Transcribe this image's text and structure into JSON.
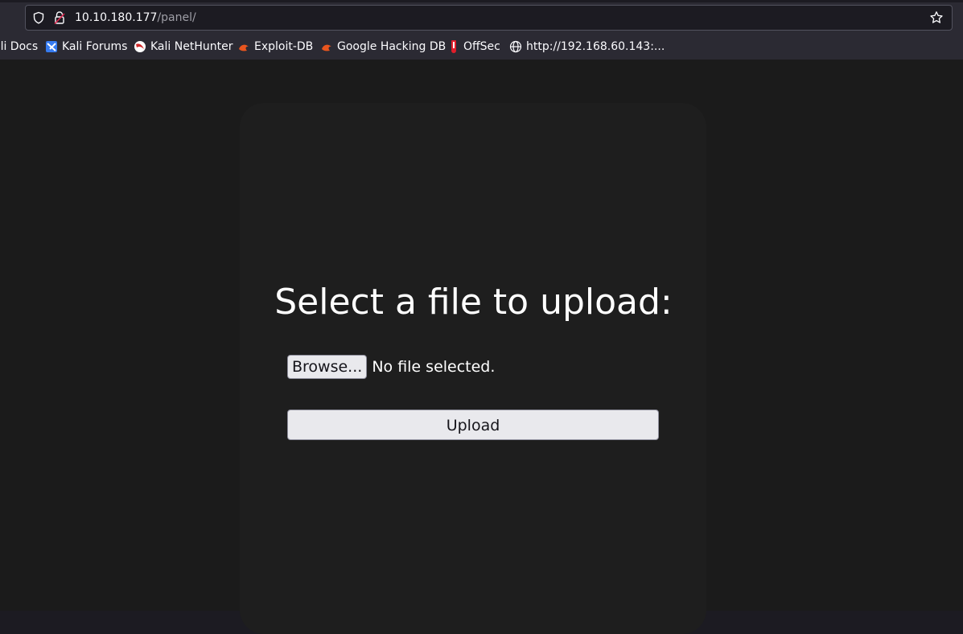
{
  "browser": {
    "url_host": "10.10.180.177",
    "url_path": "/panel/",
    "bookmarks": [
      {
        "label": "ali Docs",
        "icon": "kali-docs-icon"
      },
      {
        "label": "Kali Forums",
        "icon": "kali-forums-icon"
      },
      {
        "label": "Kali NetHunter",
        "icon": "kali-nethunter-icon"
      },
      {
        "label": "Exploit-DB",
        "icon": "exploit-db-icon"
      },
      {
        "label": "Google Hacking DB",
        "icon": "ghdb-icon"
      },
      {
        "label": "OffSec",
        "icon": "offsec-icon"
      },
      {
        "label": "http://192.168.60.143:...",
        "icon": "globe-icon"
      }
    ]
  },
  "page": {
    "heading": "Select a file to upload:",
    "browse_label": "Browse...",
    "file_status": "No file selected.",
    "upload_label": "Upload"
  },
  "colors": {
    "chrome": "#2b2a33",
    "page_background": "#1b1b1b",
    "panel": "#1e1e1e",
    "button": "#e9e9ed"
  }
}
